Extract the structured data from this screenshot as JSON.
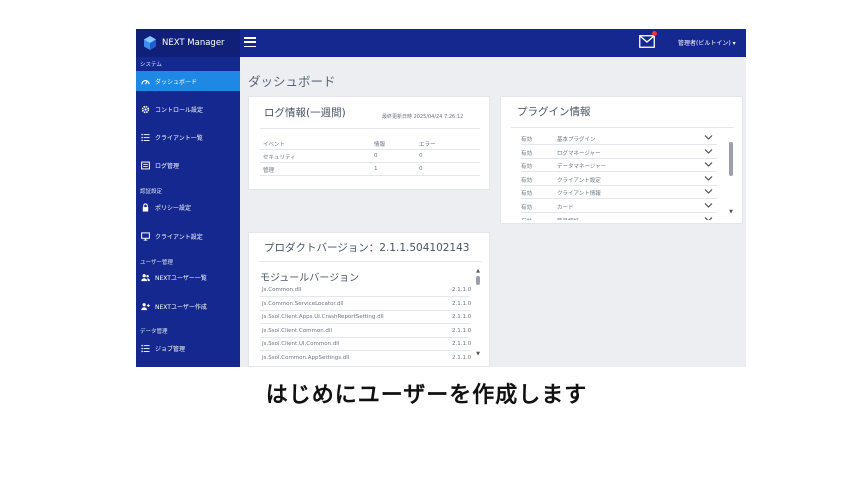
{
  "app": {
    "brand": "NEXT Manager",
    "user_menu": "管理者(ビルトイン) ▾"
  },
  "colors": {
    "sidebar": "#14288f",
    "active": "#1e88e5",
    "background": "#eceef1",
    "badge": "#e53935"
  },
  "sidebar": {
    "sections": [
      "システム",
      "認証設定",
      "ユーザー管理",
      "データ管理"
    ],
    "items": [
      {
        "label": "ダッシュボード",
        "icon": "dashboard-icon"
      },
      {
        "label": "コントロール設定",
        "icon": "gear-icon"
      },
      {
        "label": "クライアント一覧",
        "icon": "list-icon"
      },
      {
        "label": "ログ管理",
        "icon": "log-icon"
      },
      {
        "label": "ポリシー設定",
        "icon": "lock-icon"
      },
      {
        "label": "クライアント設定",
        "icon": "monitor-icon"
      },
      {
        "label": "NEXTユーザー一覧",
        "icon": "users-icon"
      },
      {
        "label": "NEXTユーザー作成",
        "icon": "add-user-icon"
      },
      {
        "label": "ジョブ管理",
        "icon": "list-icon"
      }
    ]
  },
  "main": {
    "title": "ダッシュボード",
    "log": {
      "title": "ログ情報(一週間)",
      "updated": "最終更新日時 2025/04/24 7:26:12",
      "headers": [
        "イベント",
        "情報",
        "エラー"
      ],
      "rows": [
        [
          "セキュリティ",
          "0",
          "0"
        ],
        [
          "管理",
          "1",
          "0"
        ]
      ]
    },
    "plugins": {
      "title": "プラグイン情報",
      "rows": [
        {
          "status": "有効",
          "name": "基本プラグイン"
        },
        {
          "status": "有効",
          "name": "ログマネージャー"
        },
        {
          "status": "有効",
          "name": "データマネージャー"
        },
        {
          "status": "有効",
          "name": "クライアント設定"
        },
        {
          "status": "有効",
          "name": "クライアント情報"
        },
        {
          "status": "有効",
          "name": "カード"
        },
        {
          "status": "有効",
          "name": "簡易認証"
        }
      ]
    },
    "version": {
      "title": "プロダクトバージョン：2.1.1.504102143",
      "modules_title": "モジュールバージョン",
      "modules": [
        {
          "name": "Js.Common.dll",
          "version": "2.1.1.0"
        },
        {
          "name": "Js.Common.ServiceLocator.dll",
          "version": "2.1.1.0"
        },
        {
          "name": "Js.Ssol.Client.Apps.UI.CrashReportSetting.dll",
          "version": "2.1.1.0"
        },
        {
          "name": "Js.Ssol.Client.Common.dll",
          "version": "2.1.1.0"
        },
        {
          "name": "Js.Ssol.Client.UI.Common.dll",
          "version": "2.1.1.0"
        },
        {
          "name": "Js.Ssol.Common.AppSettings.dll",
          "version": "2.1.1.0"
        }
      ]
    }
  },
  "caption": "はじめにユーザーを作成します"
}
